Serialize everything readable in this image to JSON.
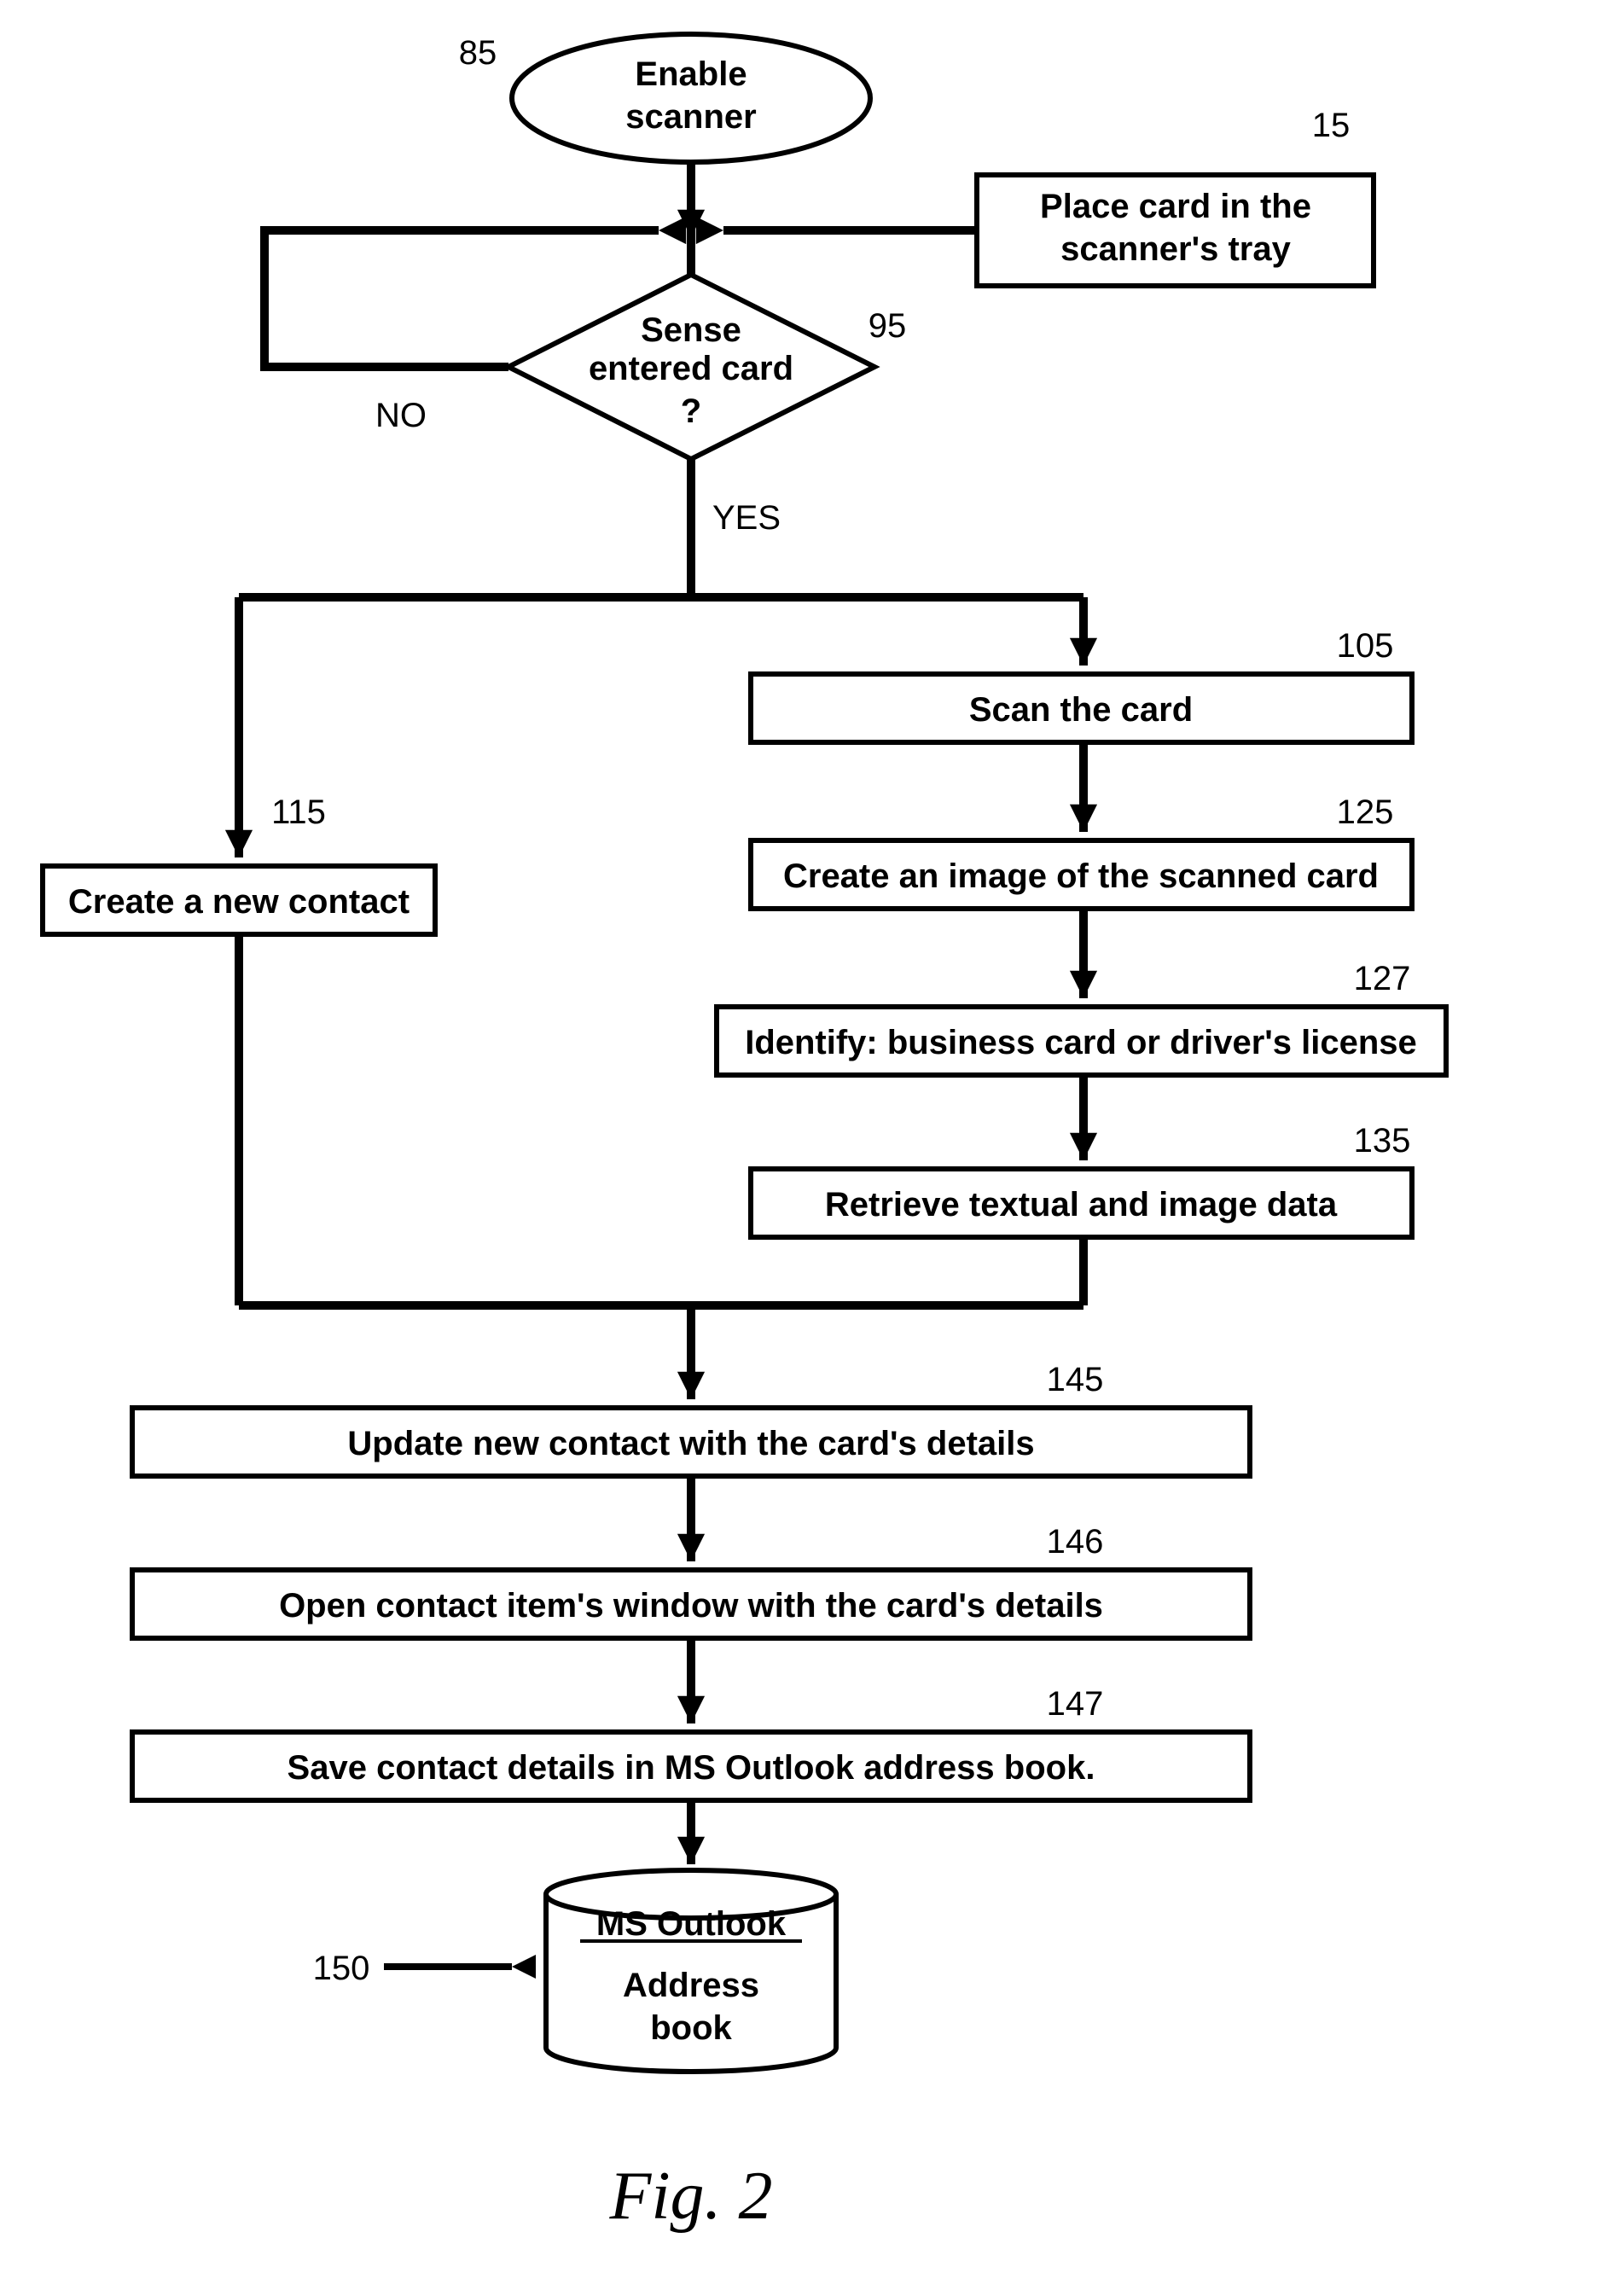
{
  "refs": {
    "r85": "85",
    "r15": "15",
    "r95": "95",
    "r115": "115",
    "r105": "105",
    "r125": "125",
    "r127": "127",
    "r135": "135",
    "r145": "145",
    "r146": "146",
    "r147": "147",
    "r150": "150"
  },
  "labels": {
    "no": "NO",
    "yes": "YES",
    "arrow": "→"
  },
  "nodes": {
    "n85": {
      "l1": "Enable",
      "l2": "scanner"
    },
    "n15": {
      "l1": "Place card in the",
      "l2": "scanner's tray"
    },
    "n95": {
      "l1": "Sense",
      "l2": "entered card",
      "l3": "?"
    },
    "n115": {
      "l1": "Create a new contact"
    },
    "n105": {
      "l1": "Scan the card"
    },
    "n125": {
      "l1": "Create an image of the scanned card"
    },
    "n127": {
      "l1": "Identify: business card or driver's license"
    },
    "n135": {
      "l1": "Retrieve textual and image data"
    },
    "n145": {
      "l1": "Update new contact with the card's details"
    },
    "n146": {
      "l1": "Open contact item's window with the card's details"
    },
    "n147": {
      "l1": "Save contact details in MS Outlook address book."
    },
    "n150": {
      "l1": "MS Outlook",
      "l2": "Address",
      "l3": "book"
    }
  },
  "figure": "Fig. 2"
}
